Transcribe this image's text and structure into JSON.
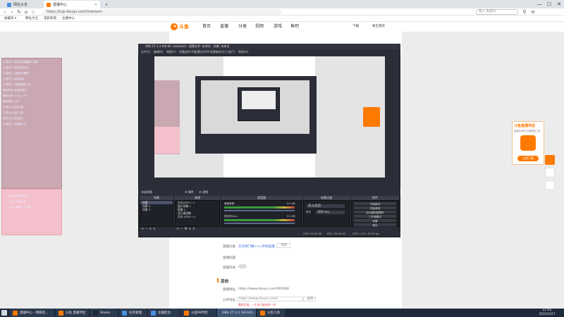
{
  "browser": {
    "tabs": [
      {
        "label": "网址大全"
      },
      {
        "label": "直播中心"
      }
    ],
    "url": "https://tup.douyu.com/liveroom",
    "search_placeholder": "输入 关键词",
    "bookmarks": [
      "收藏夹 ▾",
      "网址大全",
      "电影频道",
      "主播中心"
    ],
    "window_controls": [
      "—",
      "☐",
      "✕"
    ]
  },
  "site": {
    "logo_text": "斗鱼",
    "nav": [
      "首页",
      "直播",
      "分类",
      "视频",
      "游戏",
      "鱼吧"
    ],
    "header_right": [
      "下载",
      "帧王哈庆"
    ],
    "form": {
      "row1_label": "直播分类",
      "row1_value": "天天明门楼>>>开始直播",
      "row1_btn": "修改",
      "row2_label": "直播标题",
      "row3_label": "直播开关",
      "section_title": "其他",
      "url_label": "直播地址",
      "url_value": "https://www.douyu.com/993068",
      "share_label": "分享地址",
      "share_value": "https://www.douyu.com/",
      "share_btn": "复制",
      "share_hint": "删除后请，一天内只能修改一次"
    },
    "promo": {
      "title": "斗鱼直播伴侣",
      "subtitle": "超级好用的主播直播工具",
      "button": "立即下载"
    }
  },
  "overlay_left": {
    "lines_top": [
      "[小尾巴]: 欢迎关注直播间~谢谢",
      "[小尾巴]: 感谢送的礼物",
      "[小尾巴]: 主播好厉害啊",
      "[小尾巴]: 加油加油",
      "[小尾巴]: 今晚直播到几点",
      "最新粉丝: 欢迎新朋友",
      "最新礼物: 小心心 x10",
      "最新弹幕: 666",
      "[火箭]xx 送出火箭",
      "[飞机]xx 送出飞机",
      "[鱼丸]xx 送出鱼丸",
      "[小尾巴]: 主播晚上好"
    ],
    "lines_bottom": [
      "[公告] 直播间公告",
      "[公告] 欢迎大家",
      "[公告] 每晚八点开播"
    ]
  },
  "obs": {
    "title": "OBS 27.1.3 (64-bit, windows) - 配置文件: 未命名 - 场景: 未命名",
    "menu": [
      "文件(F)",
      "编辑(E)",
      "视图(V)",
      "停靠部件(D)",
      "配置文件(P)",
      "场景集合(S)",
      "工具(T)",
      "帮助(H)"
    ],
    "bar_label": "未选择源",
    "bar_buttons": [
      "⚙ 属性",
      "☰ 滤镜"
    ],
    "docks": {
      "scenes": {
        "title": "场景",
        "items": [
          "场景",
          "场景 2",
          "场景 3"
        ]
      },
      "sources": {
        "title": "来源",
        "items": [
          "文本(GDI+) 1",
          "窗口采集 1",
          "图像 1",
          "显示器采集",
          "文本 (GDI+) 2"
        ]
      },
      "mixer": {
        "title": "混音器",
        "channels": [
          {
            "name": "桌面音频",
            "db": "0.0 dB"
          },
          {
            "name": "麦克风/Aux",
            "db": "0.0 dB"
          }
        ]
      },
      "transitions": {
        "title": "场景过渡",
        "mode": "淡入淡出",
        "duration_label": "时长",
        "duration": "300 ms"
      },
      "controls": {
        "title": "控件",
        "buttons": [
          "开始推流",
          "开始录制",
          "启动虚拟摄像机",
          "工作室模式",
          "设置",
          "退出"
        ]
      }
    },
    "status": {
      "live": "LIVE: 00:00:00",
      "rec": "REC: 00:00:00",
      "cpu": "CPU: 1.0%, 30.00 fps"
    }
  },
  "taskbar": {
    "items": [
      "直播中心 - 网络电...",
      "斗鱼 直播伴侣",
      "Steam",
      "任务管理",
      "主播后台",
      "斗鱼PK伴侣",
      "OBS 27.1.3 (64-bit)...",
      "斗鱼工具"
    ],
    "time": "11:05",
    "date": "2022/4/27"
  },
  "colors": {
    "accent": "#ff7a00",
    "obs_bg": "#2b2e38",
    "taskbar": "#1e2a3a",
    "link": "#3a6fd8"
  }
}
